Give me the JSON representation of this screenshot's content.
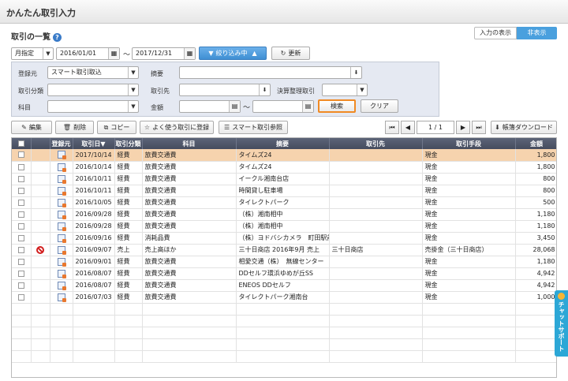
{
  "window": {
    "title": "かんたん取引入力"
  },
  "section": {
    "title": "取引の一覧",
    "help_glyph": "?"
  },
  "view_toggle": {
    "show_label": "入力の表示",
    "hide_label": "非表示"
  },
  "filter_bar": {
    "period_mode": "月指定",
    "date_from": "2016/01/01",
    "date_to": "2017/12/31",
    "tilde": "〜",
    "filter_button": "絞り込み中",
    "refresh_button": "更新"
  },
  "filter_panel": {
    "source_label": "登録元",
    "source_value": "スマート取引取込",
    "category_label": "取引分類",
    "subject_label": "科目",
    "summary_label": "摘要",
    "partner_label": "取引先",
    "settlement_label": "決算整理取引",
    "amount_label": "金額",
    "tilde": "〜",
    "search_button": "検索",
    "clear_button": "クリア"
  },
  "toolbar": {
    "edit": "編集",
    "delete": "削除",
    "copy": "コピー",
    "favorite_register": "よく使う取引に登録",
    "smart_ref": "スマート取引参照",
    "page_current": "1",
    "page_sep": "/",
    "page_total": "1",
    "download": "帳簿ダウンロード"
  },
  "table": {
    "headers": [
      "",
      "",
      "登録元",
      "取引日▼",
      "取引分類",
      "科目",
      "摘要",
      "取引先",
      "取引手段",
      "金額"
    ],
    "rows": [
      {
        "status": "",
        "date": "2017/10/14",
        "cls": "経費",
        "subject": "旅費交通費",
        "summary": "タイムズ24",
        "partner": "",
        "method": "現金",
        "amount": "1,800",
        "selected": true
      },
      {
        "status": "",
        "date": "2016/10/14",
        "cls": "経費",
        "subject": "旅費交通費",
        "summary": "タイムズ24",
        "partner": "",
        "method": "現金",
        "amount": "1,800",
        "selected": false
      },
      {
        "status": "",
        "date": "2016/10/11",
        "cls": "経費",
        "subject": "旅費交通費",
        "summary": "イークル湘南台店",
        "partner": "",
        "method": "現金",
        "amount": "800",
        "selected": false
      },
      {
        "status": "",
        "date": "2016/10/11",
        "cls": "経費",
        "subject": "旅費交通費",
        "summary": "時間貸し駐車場",
        "partner": "",
        "method": "現金",
        "amount": "800",
        "selected": false
      },
      {
        "status": "",
        "date": "2016/10/05",
        "cls": "経費",
        "subject": "旅費交通費",
        "summary": "タイレクトパーク",
        "partner": "",
        "method": "現金",
        "amount": "500",
        "selected": false
      },
      {
        "status": "",
        "date": "2016/09/28",
        "cls": "経費",
        "subject": "旅費交通費",
        "summary": "（株）湘南相中",
        "partner": "",
        "method": "現金",
        "amount": "1,180",
        "selected": false
      },
      {
        "status": "",
        "date": "2016/09/28",
        "cls": "経費",
        "subject": "旅費交通費",
        "summary": "（株）湘南相中",
        "partner": "",
        "method": "現金",
        "amount": "1,180",
        "selected": false
      },
      {
        "status": "",
        "date": "2016/09/16",
        "cls": "経費",
        "subject": "消耗品費",
        "summary": "（株）ヨドバシカメラ　町田駅前店",
        "partner": "",
        "method": "現金",
        "amount": "3,450",
        "selected": false
      },
      {
        "status": "blocked",
        "date": "2016/09/07",
        "cls": "売上",
        "subject": "売上高ほか",
        "summary": "三十日商店 2016年9月 売上",
        "partner": "三十日商店",
        "method": "売掛金（三十日商店）",
        "amount": "28,068",
        "selected": false
      },
      {
        "status": "",
        "date": "2016/09/01",
        "cls": "経費",
        "subject": "旅費交通費",
        "summary": "相愛交通（株）　無線センター",
        "partner": "",
        "method": "現金",
        "amount": "1,180",
        "selected": false
      },
      {
        "status": "",
        "date": "2016/08/07",
        "cls": "経費",
        "subject": "旅費交通費",
        "summary": "DDセルフ環浜ゆめが丘SS",
        "partner": "",
        "method": "現金",
        "amount": "4,942",
        "selected": false
      },
      {
        "status": "",
        "date": "2016/08/07",
        "cls": "経費",
        "subject": "旅費交通費",
        "summary": "ENEOS DDセルフ",
        "partner": "",
        "method": "現金",
        "amount": "4,942",
        "selected": false
      },
      {
        "status": "",
        "date": "2016/07/03",
        "cls": "経費",
        "subject": "旅費交通費",
        "summary": "タイレクトパーク湘南台",
        "partner": "",
        "method": "現金",
        "amount": "1,000",
        "selected": false
      }
    ]
  },
  "chat": {
    "label": "チャットサポート"
  }
}
